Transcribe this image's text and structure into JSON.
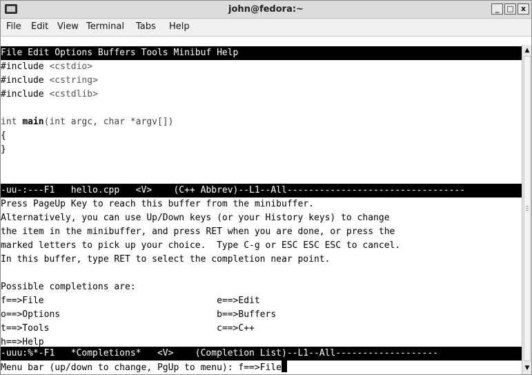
{
  "window": {
    "title": "john@fedora:~",
    "buttons": {
      "minimize": "_",
      "maximize": "□",
      "close": "x"
    }
  },
  "menubar": {
    "items": [
      "File",
      "Edit",
      "View",
      "Terminal",
      "Tabs",
      "Help"
    ]
  },
  "emacs": {
    "menubar_line": "File Edit Options Buffers Tools Minibuf Help",
    "code": {
      "l1_kw": "#include",
      "l1_arg": "<cstdio>",
      "l2_kw": "#include",
      "l2_arg": "<cstring>",
      "l3_kw": "#include",
      "l3_arg": "<cstdlib>",
      "l5_a": "int ",
      "l5_b": "main",
      "l5_c": "(int argc, char *argv[])",
      "l6": "{",
      "l7": "}"
    },
    "modeline1": "-uu-:---F1   hello.cpp   <V>    (C++ Abbrev)--L1--All---------------------------------",
    "help": [
      "Press PageUp Key to reach this buffer from the minibuffer.",
      "Alternatively, you can use Up/Down keys (or your History keys) to change",
      "the item in the minibuffer, and press RET when you are done, or press the",
      "marked letters to pick up your choice.  Type C-g or ESC ESC ESC to cancel.",
      "In this buffer, type RET to select the completion near point."
    ],
    "completions_header": "Possible completions are:",
    "completions": [
      "f==>File                                e==>Edit",
      "o==>Options                             b==>Buffers",
      "t==>Tools                               c==>C++",
      "h==>Help"
    ],
    "modeline2": "-uuu:%*-F1   *Completions*   <V>    (Completion List)--L1--All-------------------",
    "minibuffer": "Menu bar (up/down to change, PgUp to menu): f==>File"
  }
}
